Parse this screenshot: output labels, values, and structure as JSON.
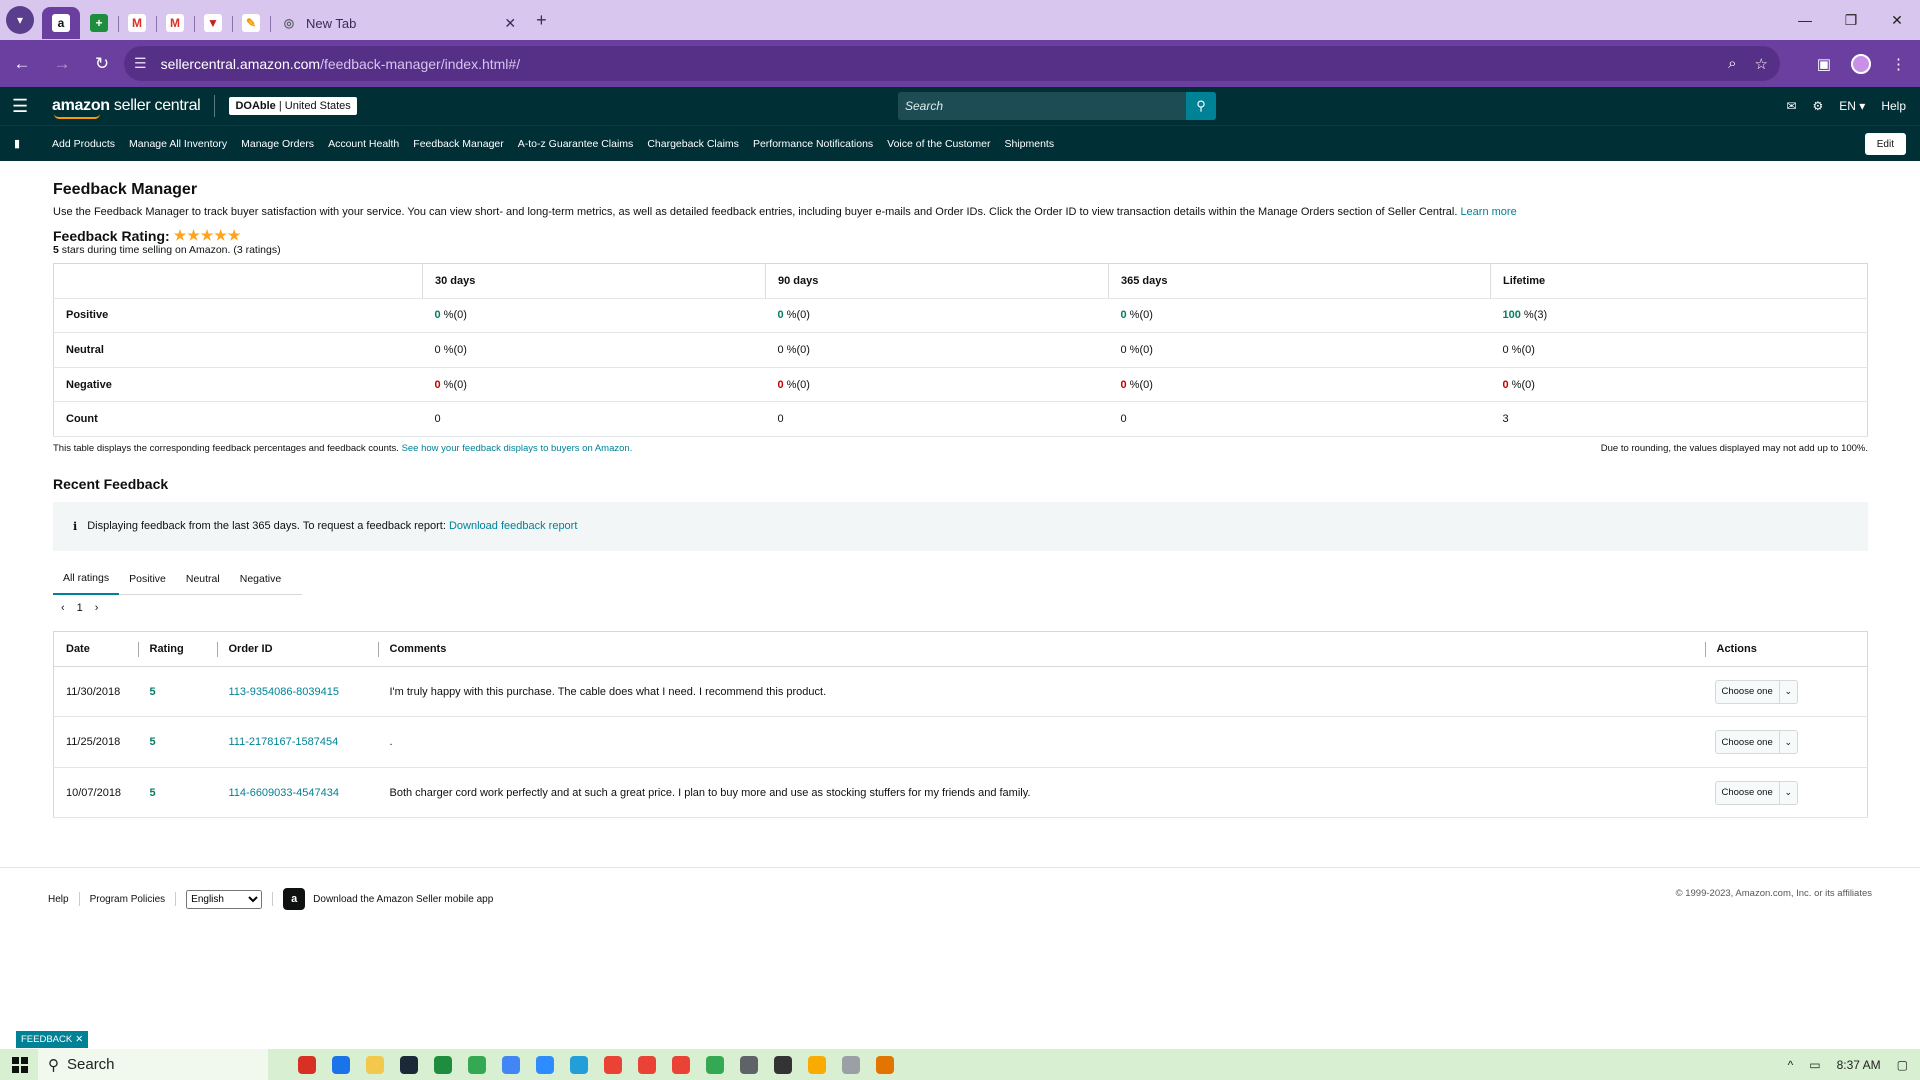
{
  "browser": {
    "tabs": [
      {
        "fav_text": "a",
        "fav_color": "#111111",
        "fav_bg": "#ffffff"
      },
      {
        "fav_text": "+",
        "fav_color": "#ffffff",
        "fav_bg": "#1e8e3e"
      },
      {
        "fav_text": "M",
        "fav_color": "#d93025",
        "fav_bg": "#ffffff"
      },
      {
        "fav_text": "M",
        "fav_color": "#d93025",
        "fav_bg": "#ffffff"
      },
      {
        "fav_text": "▼",
        "fav_color": "#c5221f",
        "fav_bg": "#ffffff"
      },
      {
        "fav_text": "✎",
        "fav_color": "#f29900",
        "fav_bg": "#ffffff"
      }
    ],
    "new_tab_title": "New Tab",
    "url_host": "sellercentral.amazon.com",
    "url_path": "/feedback-manager/index.html#/"
  },
  "header": {
    "logo_amazon": "amazon",
    "logo_rest": " seller central",
    "account_name": "DOAble",
    "account_region": "United States",
    "search_placeholder": "Search",
    "lang": "EN ▾",
    "help": "Help"
  },
  "nav": {
    "items": [
      "Add Products",
      "Manage All Inventory",
      "Manage Orders",
      "Account Health",
      "Feedback Manager",
      "A-to-z Guarantee Claims",
      "Chargeback Claims",
      "Performance Notifications",
      "Voice of the Customer",
      "Shipments"
    ],
    "edit": "Edit"
  },
  "page": {
    "title": "Feedback Manager",
    "description": "Use the Feedback Manager to track buyer satisfaction with your service. You can view short- and long-term metrics, as well as detailed feedback entries, including buyer e-mails and Order IDs. Click the Order ID to view transaction details within the Manage Orders section of Seller Central.",
    "learn_more": "Learn more",
    "rating_label": "Feedback Rating:",
    "stars": "★★★★★",
    "rating_score": "5",
    "rating_sub": " stars during time selling on Amazon. (3 ratings)"
  },
  "metrics": {
    "headers": [
      "",
      "30 days",
      "90 days",
      "365 days",
      "Lifetime"
    ],
    "rows": [
      {
        "label": "Positive",
        "cells": [
          {
            "n": "0",
            "s": " %(0)"
          },
          {
            "n": "0",
            "s": " %(0)"
          },
          {
            "n": "0",
            "s": " %(0)"
          },
          {
            "n": "100",
            "s": " %(3)"
          }
        ]
      },
      {
        "label": "Neutral",
        "cells": [
          {
            "n": "0",
            "s": " %(0)"
          },
          {
            "n": "0",
            "s": " %(0)"
          },
          {
            "n": "0",
            "s": " %(0)"
          },
          {
            "n": "0",
            "s": " %(0)"
          }
        ]
      },
      {
        "label": "Negative",
        "cells": [
          {
            "n": "0",
            "s": " %(0)"
          },
          {
            "n": "0",
            "s": " %(0)"
          },
          {
            "n": "0",
            "s": " %(0)"
          },
          {
            "n": "0",
            "s": " %(0)"
          }
        ]
      },
      {
        "label": "Count",
        "cells": [
          {
            "n": "0",
            "s": ""
          },
          {
            "n": "0",
            "s": ""
          },
          {
            "n": "0",
            "s": ""
          },
          {
            "n": "3",
            "s": ""
          }
        ]
      }
    ],
    "footnote": "This table displays the corresponding feedback percentages and feedback counts.",
    "footnote_link": "See how your feedback displays to buyers on Amazon.",
    "rounding_note": "Due to rounding, the values displayed may not add up to 100%."
  },
  "recent": {
    "title": "Recent Feedback",
    "info_icon": "i",
    "info_text": "Displaying feedback from the last 365 days. To request a feedback report:",
    "info_link": "Download feedback report",
    "tabs": [
      "All ratings",
      "Positive",
      "Neutral",
      "Negative"
    ],
    "page": "1",
    "columns": [
      "Date",
      "Rating",
      "Order ID",
      "Comments",
      "Actions"
    ],
    "rows": [
      {
        "date": "11/30/2018",
        "rating": "5",
        "order": "113-9354086-8039415",
        "comment": "I'm truly happy with this purchase. The cable does what I need. I recommend this product.",
        "action": "Choose one"
      },
      {
        "date": "11/25/2018",
        "rating": "5",
        "order": "111-2178167-1587454",
        "comment": ".",
        "action": "Choose one"
      },
      {
        "date": "10/07/2018",
        "rating": "5",
        "order": "114-6609033-4547434",
        "comment": "Both charger cord work perfectly and at such a great price. I plan to buy more and use as stocking stuffers for my friends and family.",
        "action": "Choose one"
      }
    ]
  },
  "footer": {
    "help": "Help",
    "policies": "Program Policies",
    "language": "English",
    "app_text": "Download the Amazon Seller mobile app",
    "copyright": "© 1999-2023, Amazon.com, Inc. or its affiliates"
  },
  "feedback_tab": "FEEDBACK",
  "taskbar": {
    "search": "Search",
    "time": "8:37 AM",
    "icon_colors": [
      "#d93025",
      "#1a73e8",
      "#f2c94c",
      "#1b2838",
      "#1e8e3e",
      "#34a853",
      "#4285f4",
      "#2d8cff",
      "#229ed9",
      "#ea4335",
      "#ea4335",
      "#ea4335",
      "#34a853",
      "#5f6368",
      "#333333",
      "#f9ab00",
      "#9aa0a6",
      "#e37400"
    ]
  }
}
